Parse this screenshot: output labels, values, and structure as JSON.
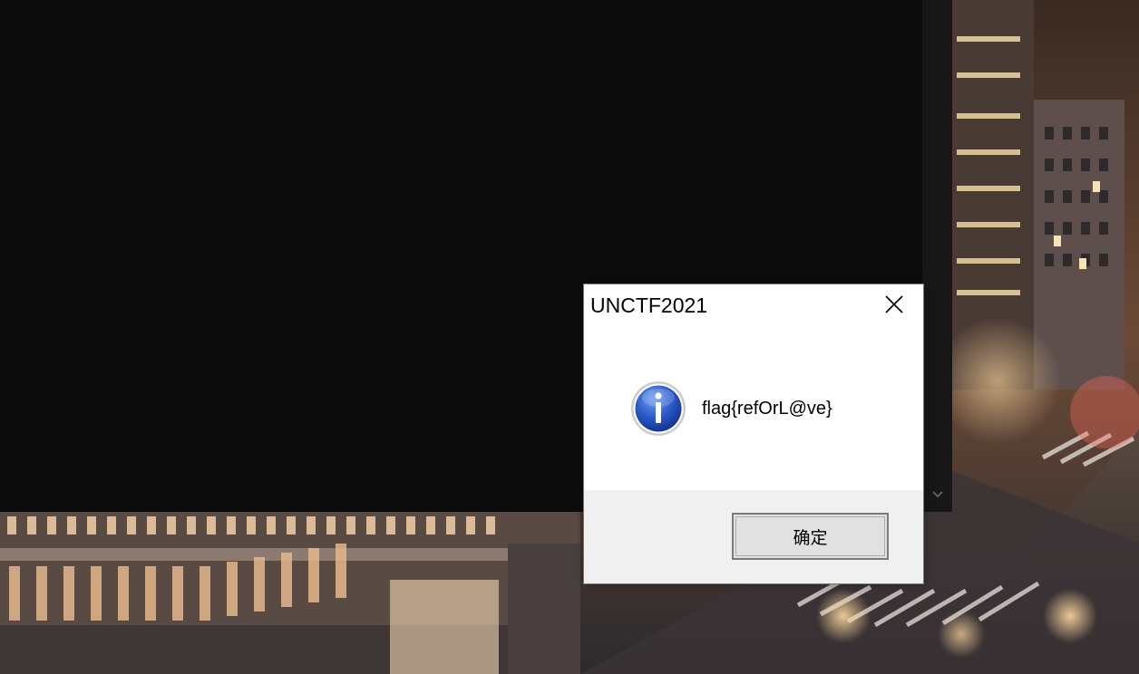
{
  "dialog": {
    "title": "UNCTF2021",
    "message": "flag{refOrL@ve}",
    "ok_label": "确定",
    "close_icon": "close-icon",
    "message_icon": "info-icon"
  },
  "console": {
    "scroll_icon": "chevron-down-icon"
  },
  "colors": {
    "console_bg": "#0c0c0c",
    "dialog_bg": "#ffffff",
    "dialog_footer_bg": "#f0f0f0",
    "button_bg": "#e1e1e1"
  }
}
